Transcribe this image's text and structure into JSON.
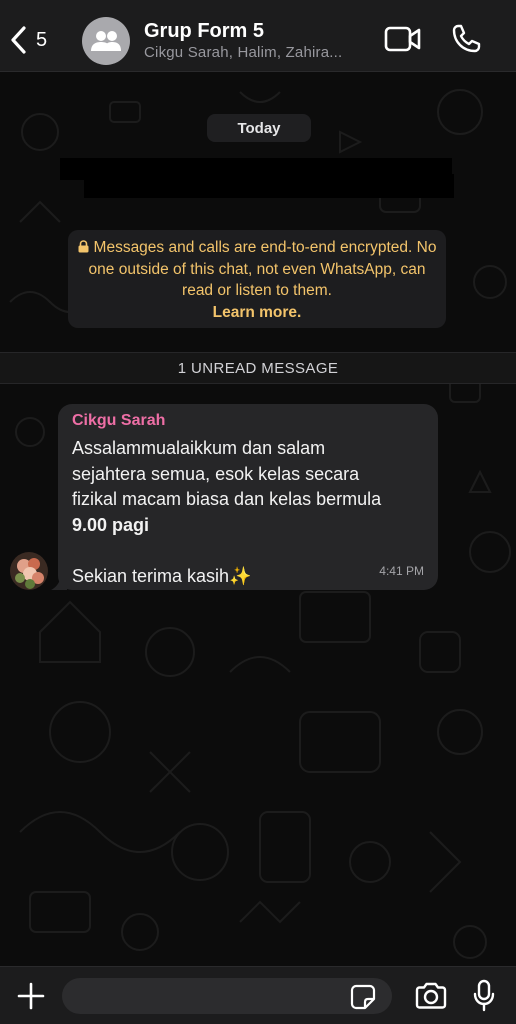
{
  "header": {
    "back_count": "5",
    "title": "Grup Form 5",
    "subtitle": "Cikgu Sarah, Halim, Zahira..."
  },
  "chat": {
    "date_label": "Today",
    "encryption_notice": "Messages and calls are end-to-end encrypted. No one outside of this chat, not even WhatsApp, can read or listen to them.",
    "encryption_link": "Learn more.",
    "unread_label": "1 UNREAD MESSAGE",
    "message": {
      "sender": "Cikgu Sarah",
      "sender_color": "#ee6fa6",
      "line1": "Assalammualaikkum dan  salam",
      "line2": "sejahtera semua, esok kelas secara",
      "line3": "fizikal macam biasa dan kelas bermula",
      "line4_bold": "9.00 pagi",
      "line5": "Sekian terima kasih✨",
      "time": "4:41 PM"
    }
  },
  "composer": {
    "placeholder": ""
  },
  "colors": {
    "encryption_text": "#f3c46b",
    "bubble": "#262628",
    "header": "#1c1c1d"
  }
}
